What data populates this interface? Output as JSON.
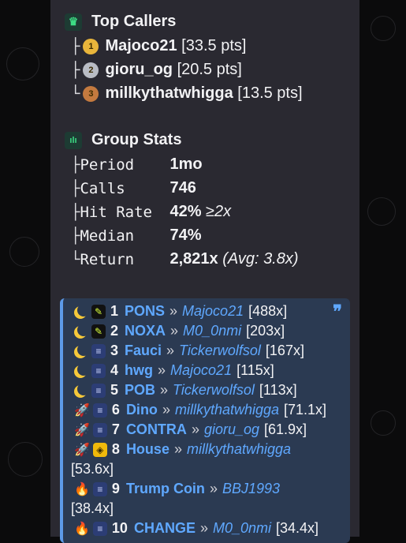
{
  "top_callers": {
    "title": "Top Callers",
    "items": [
      {
        "tree": "├",
        "rank": "1",
        "name": "Majoco21",
        "pts": "[33.5 pts]",
        "medal_color": "#e9b53b"
      },
      {
        "tree": "├",
        "rank": "2",
        "name": "gioru_og",
        "pts": "[20.5 pts]",
        "medal_color": "#b9bcc4"
      },
      {
        "tree": "└",
        "rank": "3",
        "name": "millkythatwhigga",
        "pts": "[13.5 pts]",
        "medal_color": "#c47a3f"
      }
    ]
  },
  "group_stats": {
    "title": "Group Stats",
    "rows": [
      {
        "tree": "├",
        "label": "Period",
        "value": "1mo",
        "extra": ""
      },
      {
        "tree": "├",
        "label": "Calls",
        "value": "746",
        "extra": ""
      },
      {
        "tree": "├",
        "label": "Hit Rate",
        "value": "42%",
        "extra": "≥2x"
      },
      {
        "tree": "├",
        "label": "Median",
        "value": "74%",
        "extra": ""
      },
      {
        "tree": "└",
        "label": "Return",
        "value": "2,821x",
        "extra": "(Avg: 3.8x)"
      }
    ]
  },
  "calls_list": [
    {
      "rank": "1",
      "ticker": "PONS",
      "sep": "»",
      "caller": "Majoco21",
      "mult": "[488x]",
      "status_icon": "moon-icon",
      "chain_icon": "pen-icon"
    },
    {
      "rank": "2",
      "ticker": "NOXA",
      "sep": "»",
      "caller": "M0_0nmi",
      "mult": "[203x]",
      "status_icon": "moon-icon",
      "chain_icon": "pen-icon"
    },
    {
      "rank": "3",
      "ticker": "Fauci",
      "sep": "»",
      "caller": "Tickerwolfsol",
      "mult": "[167x]",
      "status_icon": "moon-icon",
      "chain_icon": "solana-icon"
    },
    {
      "rank": "4",
      "ticker": "hwg",
      "sep": "»",
      "caller": "Majoco21",
      "mult": "[115x]",
      "status_icon": "moon-icon",
      "chain_icon": "solana-icon"
    },
    {
      "rank": "5",
      "ticker": "POB",
      "sep": "»",
      "caller": "Tickerwolfsol",
      "mult": "[113x]",
      "status_icon": "moon-icon",
      "chain_icon": "solana-icon"
    },
    {
      "rank": "6",
      "ticker": "Dino",
      "sep": "»",
      "caller": "millkythatwhigga",
      "mult": "[71.1x]",
      "status_icon": "rocket-icon",
      "chain_icon": "solana-icon"
    },
    {
      "rank": "7",
      "ticker": "CONTRA",
      "sep": "»",
      "caller": "gioru_og",
      "mult": "[61.9x]",
      "status_icon": "rocket-icon",
      "chain_icon": "solana-icon"
    },
    {
      "rank": "8",
      "ticker": "House",
      "sep": "»",
      "caller": "millkythatwhigga",
      "mult": "[53.6x]",
      "status_icon": "rocket-icon",
      "chain_icon": "bnb-icon"
    },
    {
      "rank": "9",
      "ticker": "Trump Coin",
      "sep": "»",
      "caller": "BBJ1993",
      "mult": "[38.4x]",
      "status_icon": "fire-icon",
      "chain_icon": "solana-icon"
    },
    {
      "rank": "10",
      "ticker": "CHANGE",
      "sep": "»",
      "caller": "M0_0nmi",
      "mult": "[34.4x]",
      "status_icon": "fire-icon",
      "chain_icon": "solana-icon"
    }
  ],
  "glyphs": {
    "crown": "♛",
    "bars": "ılı",
    "quote": "❞",
    "pen": "✎",
    "sol": "≡",
    "bnb": "◈",
    "rocket": "🚀",
    "fire": "🔥"
  },
  "colors": {
    "bubble": "#2a2931",
    "quote_bg": "#2b3a52",
    "quote_bar": "#5d9ae8",
    "link": "#5fa8ff"
  }
}
